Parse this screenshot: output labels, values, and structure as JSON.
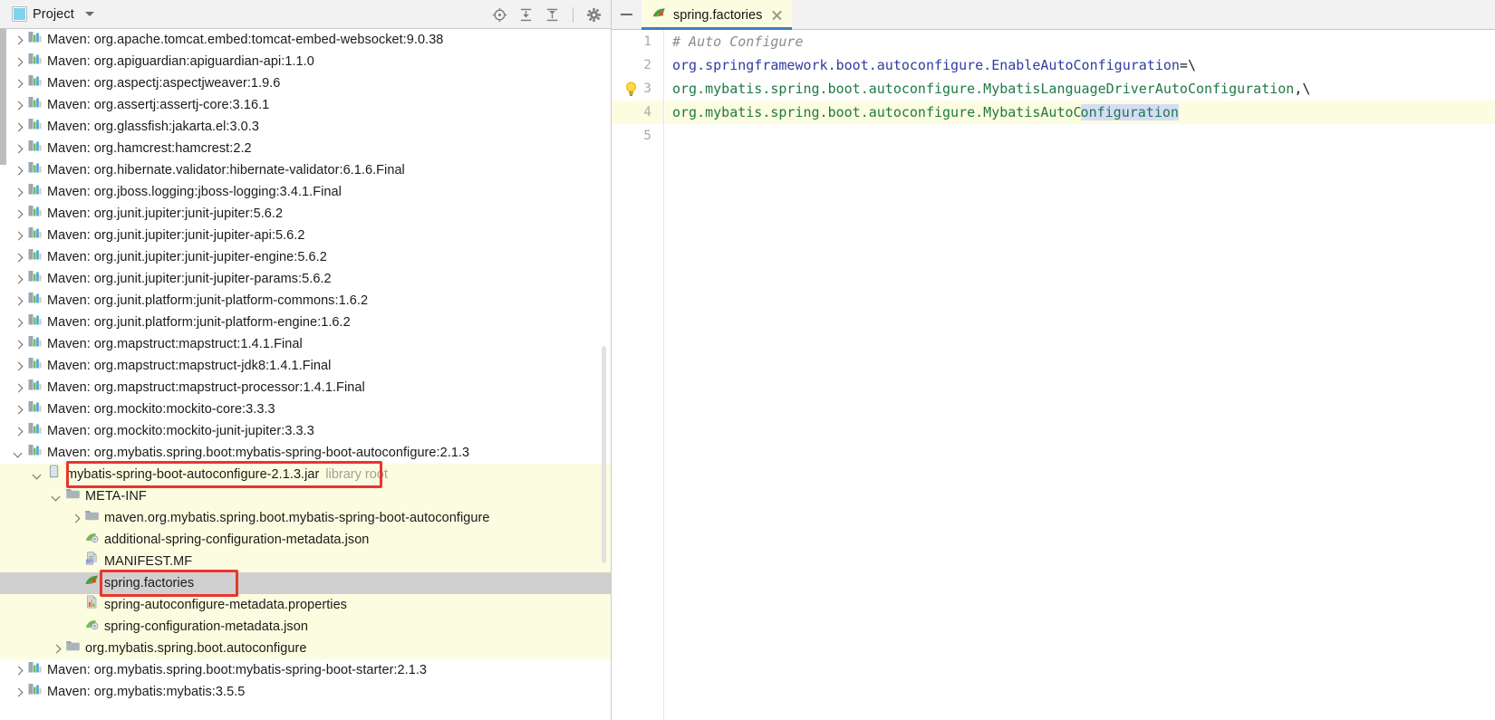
{
  "tool_window": {
    "title": "Project",
    "icon": "project-panel-icon",
    "dropdown_icon": "chevron-down-icon",
    "actions": [
      {
        "name": "locate-icon",
        "tooltip": "Select Opened File"
      },
      {
        "name": "expand-all-icon",
        "tooltip": "Expand All"
      },
      {
        "name": "collapse-all-icon",
        "tooltip": "Collapse All"
      },
      {
        "name": "gear-icon",
        "tooltip": "Settings"
      }
    ]
  },
  "editor_window": {
    "minimize_icon": "minimize-icon",
    "tab": {
      "label": "spring.factories",
      "icon": "spring-leaf-icon",
      "close_icon": "close-icon",
      "active": true
    },
    "line_numbers": [
      "1",
      "2",
      "3",
      "4",
      "5"
    ],
    "current_line": 4,
    "gutter_icon_line": 3,
    "gutter_icon": "lightbulb-icon",
    "lines": [
      {
        "n": 1,
        "segments": [
          {
            "text": "# Auto Configure",
            "style": "comment"
          }
        ]
      },
      {
        "n": 2,
        "segments": [
          {
            "text": "org.springframework.boot.autoconfigure.EnableAutoConfiguration",
            "style": "key"
          },
          {
            "text": "=\\",
            "style": "op"
          }
        ]
      },
      {
        "n": 3,
        "segments": [
          {
            "text": "org.mybatis.spring.boot.autoconfigure.MybatisLanguageDriverAutoConfiguration",
            "style": "value"
          },
          {
            "text": ",\\",
            "style": "op"
          }
        ]
      },
      {
        "n": 4,
        "segments": [
          {
            "text": "org.mybatis.spring.boot.autoconfigure.MybatisAutoC",
            "style": "value"
          },
          {
            "text": "onfiguration",
            "style": "value-selected"
          }
        ]
      },
      {
        "n": 5,
        "segments": []
      }
    ]
  },
  "tree": {
    "library_root_note": "library root",
    "rows": [
      {
        "label": "Maven: org.apache.tomcat.embed:tomcat-embed-websocket:9.0.38",
        "indent": 1,
        "twisty": "right",
        "icon": "maven-library-icon"
      },
      {
        "label": "Maven: org.apiguardian:apiguardian-api:1.1.0",
        "indent": 1,
        "twisty": "right",
        "icon": "maven-library-icon"
      },
      {
        "label": "Maven: org.aspectj:aspectjweaver:1.9.6",
        "indent": 1,
        "twisty": "right",
        "icon": "maven-library-icon"
      },
      {
        "label": "Maven: org.assertj:assertj-core:3.16.1",
        "indent": 1,
        "twisty": "right",
        "icon": "maven-library-icon"
      },
      {
        "label": "Maven: org.glassfish:jakarta.el:3.0.3",
        "indent": 1,
        "twisty": "right",
        "icon": "maven-library-icon"
      },
      {
        "label": "Maven: org.hamcrest:hamcrest:2.2",
        "indent": 1,
        "twisty": "right",
        "icon": "maven-library-icon"
      },
      {
        "label": "Maven: org.hibernate.validator:hibernate-validator:6.1.6.Final",
        "indent": 1,
        "twisty": "right",
        "icon": "maven-library-icon"
      },
      {
        "label": "Maven: org.jboss.logging:jboss-logging:3.4.1.Final",
        "indent": 1,
        "twisty": "right",
        "icon": "maven-library-icon"
      },
      {
        "label": "Maven: org.junit.jupiter:junit-jupiter:5.6.2",
        "indent": 1,
        "twisty": "right",
        "icon": "maven-library-icon"
      },
      {
        "label": "Maven: org.junit.jupiter:junit-jupiter-api:5.6.2",
        "indent": 1,
        "twisty": "right",
        "icon": "maven-library-icon"
      },
      {
        "label": "Maven: org.junit.jupiter:junit-jupiter-engine:5.6.2",
        "indent": 1,
        "twisty": "right",
        "icon": "maven-library-icon"
      },
      {
        "label": "Maven: org.junit.jupiter:junit-jupiter-params:5.6.2",
        "indent": 1,
        "twisty": "right",
        "icon": "maven-library-icon"
      },
      {
        "label": "Maven: org.junit.platform:junit-platform-commons:1.6.2",
        "indent": 1,
        "twisty": "right",
        "icon": "maven-library-icon"
      },
      {
        "label": "Maven: org.junit.platform:junit-platform-engine:1.6.2",
        "indent": 1,
        "twisty": "right",
        "icon": "maven-library-icon"
      },
      {
        "label": "Maven: org.mapstruct:mapstruct:1.4.1.Final",
        "indent": 1,
        "twisty": "right",
        "icon": "maven-library-icon"
      },
      {
        "label": "Maven: org.mapstruct:mapstruct-jdk8:1.4.1.Final",
        "indent": 1,
        "twisty": "right",
        "icon": "maven-library-icon"
      },
      {
        "label": "Maven: org.mapstruct:mapstruct-processor:1.4.1.Final",
        "indent": 1,
        "twisty": "right",
        "icon": "maven-library-icon"
      },
      {
        "label": "Maven: org.mockito:mockito-core:3.3.3",
        "indent": 1,
        "twisty": "right",
        "icon": "maven-library-icon"
      },
      {
        "label": "Maven: org.mockito:mockito-junit-jupiter:3.3.3",
        "indent": 1,
        "twisty": "right",
        "icon": "maven-library-icon"
      },
      {
        "label": "Maven: org.mybatis.spring.boot:mybatis-spring-boot-autoconfigure:2.1.3",
        "indent": 1,
        "twisty": "down",
        "icon": "maven-library-icon"
      },
      {
        "label": "mybatis-spring-boot-autoconfigure-2.1.3.jar",
        "indent": 2,
        "twisty": "down",
        "icon": "jar-icon",
        "highlighted": true,
        "note": "library root",
        "annotated": true
      },
      {
        "label": "META-INF",
        "indent": 3,
        "twisty": "down",
        "icon": "folder-icon",
        "highlighted": true
      },
      {
        "label": "maven.org.mybatis.spring.boot.mybatis-spring-boot-autoconfigure",
        "indent": 4,
        "twisty": "right",
        "icon": "folder-icon",
        "highlighted": true
      },
      {
        "label": "additional-spring-configuration-metadata.json",
        "indent": 4,
        "twisty": "none",
        "icon": "spring-config-json-icon",
        "highlighted": true
      },
      {
        "label": "MANIFEST.MF",
        "indent": 4,
        "twisty": "none",
        "icon": "manifest-icon",
        "highlighted": true
      },
      {
        "label": "spring.factories",
        "indent": 4,
        "twisty": "none",
        "icon": "spring-leaf-icon",
        "selected": true,
        "annotated": true
      },
      {
        "label": "spring-autoconfigure-metadata.properties",
        "indent": 4,
        "twisty": "none",
        "icon": "properties-icon",
        "highlighted": true
      },
      {
        "label": "spring-configuration-metadata.json",
        "indent": 4,
        "twisty": "none",
        "icon": "spring-config-json-icon",
        "highlighted": true
      },
      {
        "label": "org.mybatis.spring.boot.autoconfigure",
        "indent": 3,
        "twisty": "right",
        "icon": "folder-icon",
        "highlighted": true
      },
      {
        "label": "Maven: org.mybatis.spring.boot:mybatis-spring-boot-starter:2.1.3",
        "indent": 1,
        "twisty": "right",
        "icon": "maven-library-icon"
      },
      {
        "label": "Maven: org.mybatis:mybatis:3.5.5",
        "indent": 1,
        "twisty": "right",
        "icon": "maven-library-icon"
      }
    ]
  },
  "colors": {
    "annotation_red": "#e8362c",
    "highlight_yellow": "#fcfce0",
    "selection_gray": "#d0d0d0",
    "tab_underline_blue": "#3f7cc4",
    "code_key_blue": "#2f3d9e",
    "code_value_green": "#1f7a45",
    "code_comment_gray": "#8c8c8c",
    "text_selection_lavender": "#d6dcf7"
  }
}
